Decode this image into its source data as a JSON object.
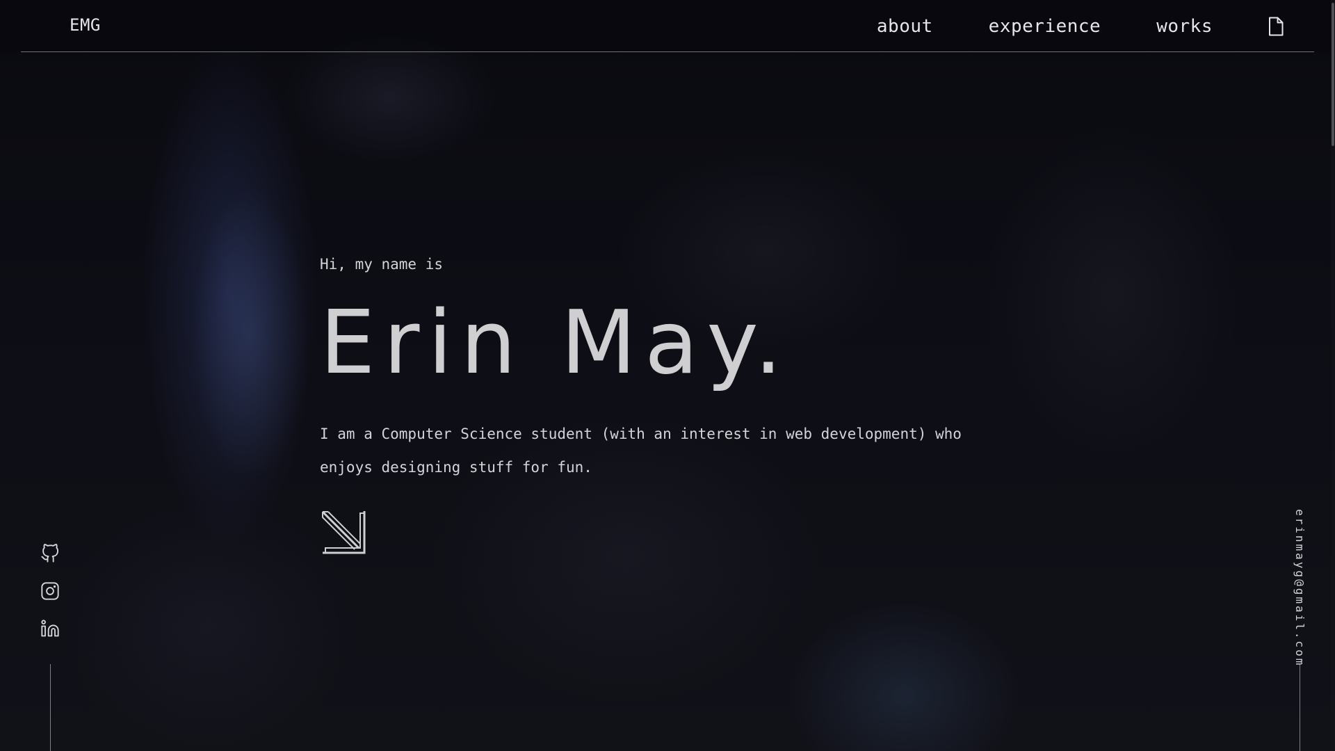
{
  "header": {
    "logo": "EMG",
    "nav": [
      {
        "label": "about"
      },
      {
        "label": "experience"
      },
      {
        "label": "works"
      }
    ],
    "resume_icon": "document-icon"
  },
  "hero": {
    "greeting": "Hi, my name is",
    "name": "Erin May.",
    "intro": "I am a Computer Science student (with an interest in web development) who enjoys designing stuff for fun.",
    "cta_icon": "arrow-down-right-icon"
  },
  "socials": [
    {
      "icon": "github-icon"
    },
    {
      "icon": "instagram-icon"
    },
    {
      "icon": "linkedin-icon"
    }
  ],
  "contact": {
    "email": "erinmayg@gmail.com"
  },
  "colors": {
    "background": "#0b0b12",
    "text": "#d8d8dc",
    "accent_smoke": "#4a5aa8"
  }
}
